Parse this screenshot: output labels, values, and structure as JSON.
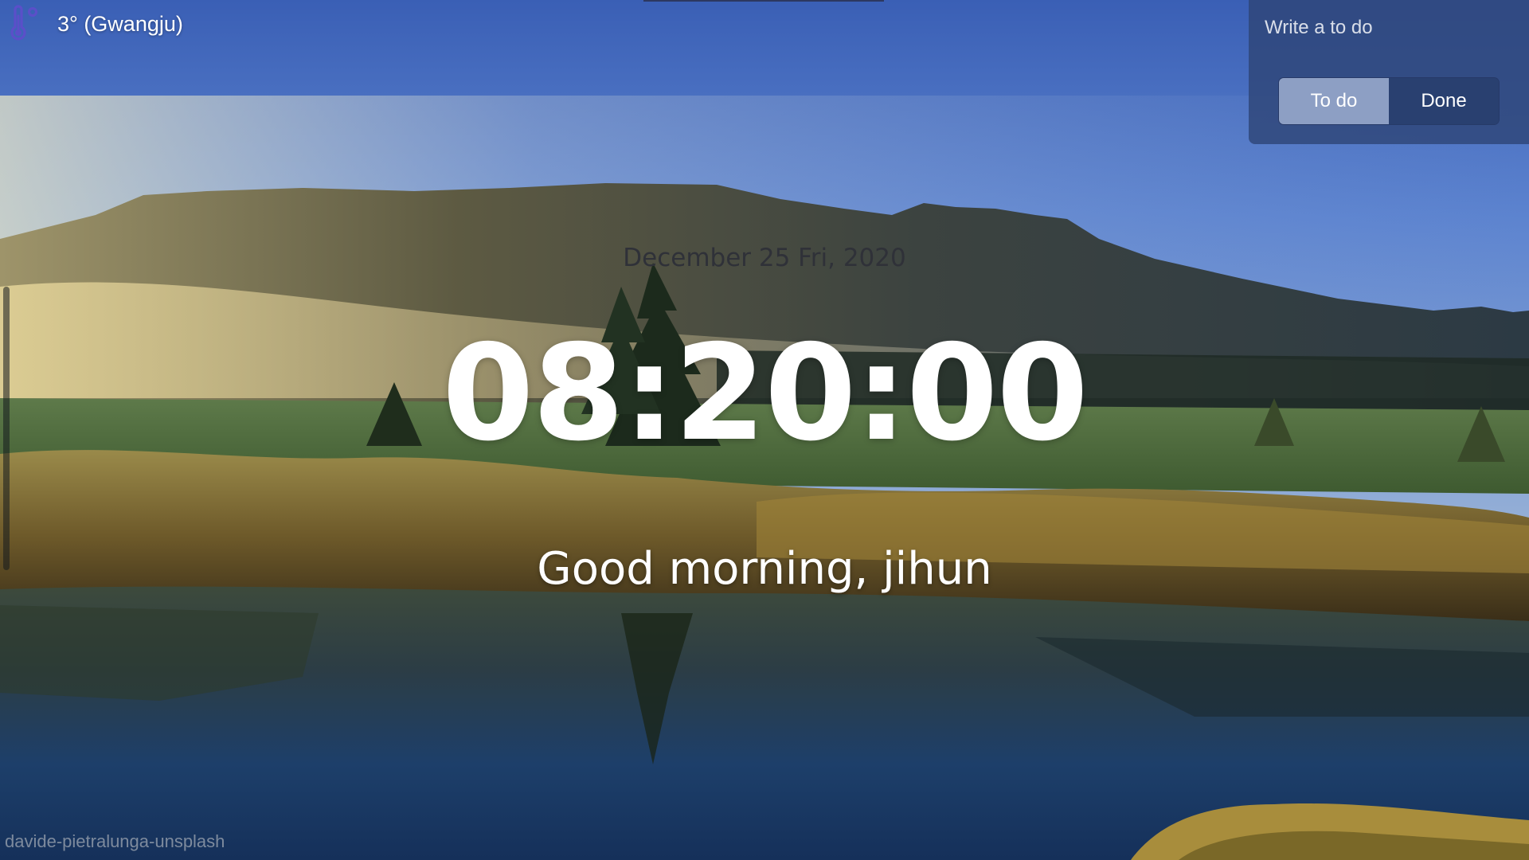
{
  "weather": {
    "text": "3° (Gwangju)",
    "icon": "thermometer-icon"
  },
  "todo": {
    "placeholder": "Write a to do",
    "tabs": [
      {
        "label": "To do",
        "active": true
      },
      {
        "label": "Done",
        "active": false
      }
    ]
  },
  "clock": {
    "date": "December 25 Fri, 2020",
    "time": "08:20:00",
    "greeting": "Good morning, jihun"
  },
  "background": {
    "credit": "davide-pietralunga-unsplash"
  },
  "colors": {
    "accent_icon": "#5b4fc9",
    "panel": "#2e4678",
    "active_tab": "#8d9fc4"
  }
}
